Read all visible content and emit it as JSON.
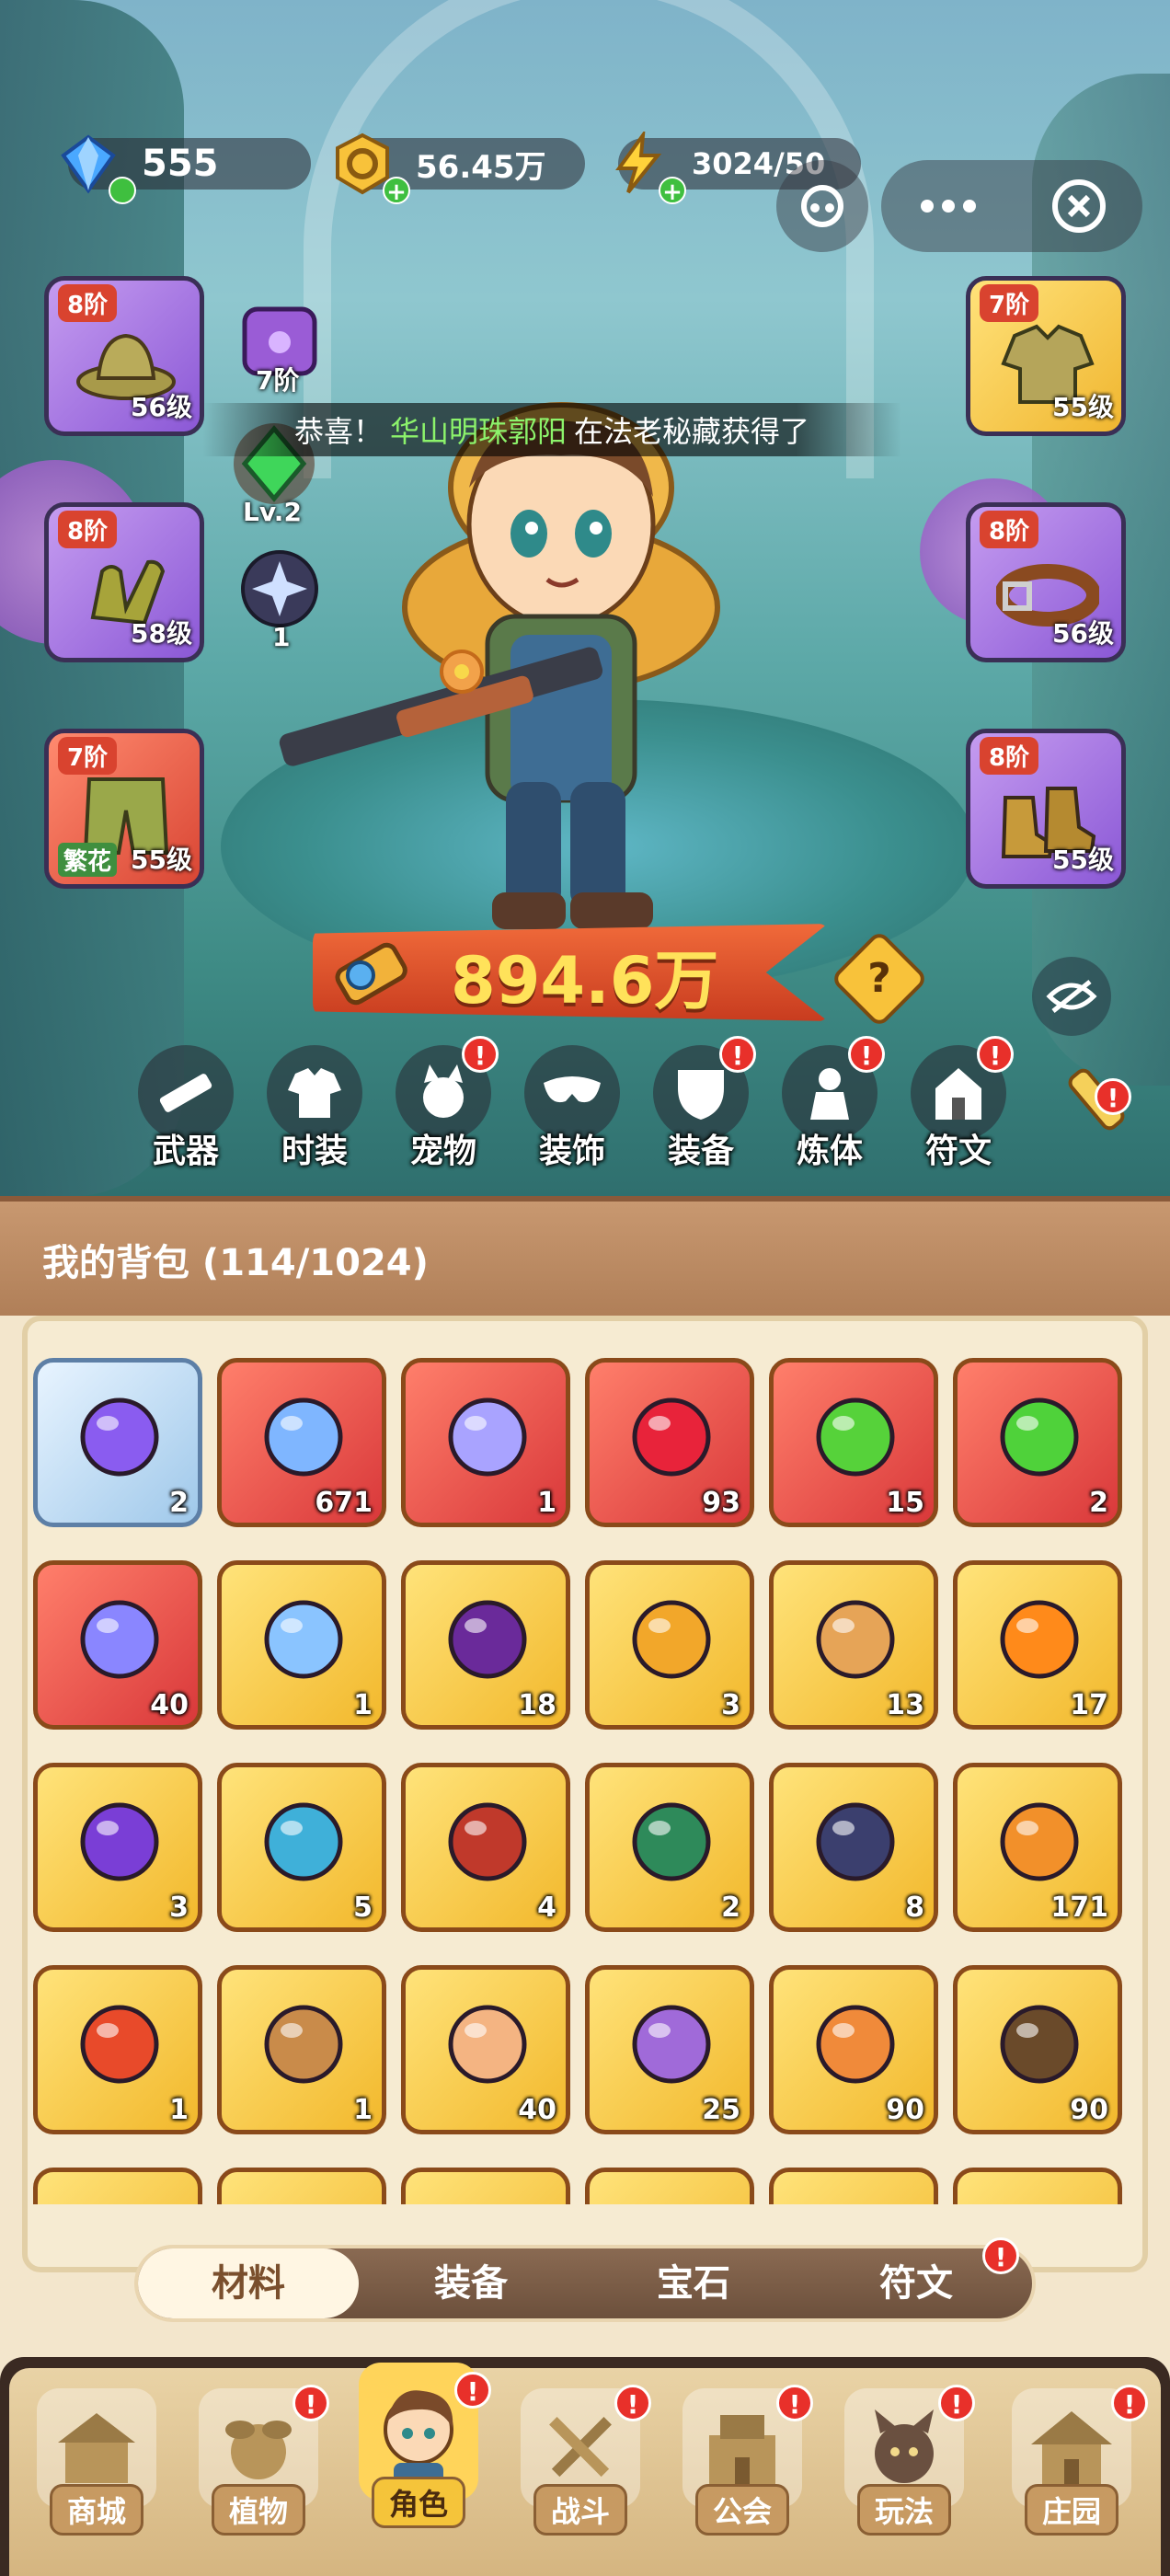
{
  "currencies": [
    {
      "name": "gem",
      "icon": "gem-icon",
      "value": "555"
    },
    {
      "name": "gold",
      "icon": "gold-coin-icon",
      "value": "56.45万"
    },
    {
      "name": "energy",
      "icon": "lightning-icon",
      "value": "3024/50"
    }
  ],
  "equipment_left": [
    {
      "tier": "8阶",
      "level": "56级",
      "icon": "hat-icon",
      "tag": ""
    },
    {
      "tier": "8阶",
      "level": "58级",
      "icon": "gloves-icon",
      "tag": ""
    },
    {
      "tier": "7阶",
      "level": "55级",
      "icon": "pants-icon",
      "tag": "繁花"
    }
  ],
  "equipment_right": [
    {
      "tier": "7阶",
      "level": "55级",
      "icon": "shirt-icon"
    },
    {
      "tier": "8阶",
      "level": "56级",
      "icon": "belt-icon"
    },
    {
      "tier": "8阶",
      "level": "55级",
      "icon": "boots-icon"
    }
  ],
  "side_icons": [
    {
      "label": "7阶",
      "icon": "paw-bag-icon"
    },
    {
      "label": "Lv.2",
      "icon": "green-gem-icon"
    },
    {
      "label": "1",
      "icon": "star-orb-icon"
    }
  ],
  "notice": {
    "prefix": "恭喜！",
    "player": "华山明珠郭阳",
    "suffix": "在法老秘藏获得了"
  },
  "power": "894.6万",
  "help_symbol": "?",
  "functions": [
    {
      "label": "武器",
      "icon": "weapon-icon",
      "alert": false
    },
    {
      "label": "时装",
      "icon": "outfit-icon",
      "alert": false
    },
    {
      "label": "宠物",
      "icon": "pet-icon",
      "alert": true
    },
    {
      "label": "装饰",
      "icon": "mask-icon",
      "alert": false
    },
    {
      "label": "装备",
      "icon": "equipment-icon",
      "alert": true
    },
    {
      "label": "炼体",
      "icon": "body-refine-icon",
      "alert": true
    },
    {
      "label": "符文",
      "icon": "rune-icon",
      "alert": true
    }
  ],
  "alert_symbol": "!",
  "bag": {
    "title": "我的背包 (114/1024)",
    "items": [
      {
        "icon": "golden-ring-icon",
        "count": "2",
        "rarity": "blue",
        "color": "#8a5cf0"
      },
      {
        "icon": "star-crystal-icon",
        "count": "671",
        "rarity": "red",
        "color": "#7fb6ff"
      },
      {
        "icon": "moon-star-icon",
        "count": "1",
        "rarity": "red",
        "color": "#a9a3ff"
      },
      {
        "icon": "red-potion-icon",
        "count": "93",
        "rarity": "red",
        "color": "#e8233a"
      },
      {
        "icon": "green-tube-icon",
        "count": "15",
        "rarity": "red",
        "color": "#56d23a"
      },
      {
        "icon": "green-capsule-icon",
        "count": "2",
        "rarity": "red",
        "color": "#4fd23a"
      },
      {
        "icon": "purple-cubes-icon",
        "count": "40",
        "rarity": "red",
        "color": "#8a86ff"
      },
      {
        "icon": "water-drop-icon",
        "count": "1",
        "rarity": "gold",
        "color": "#8ac4ff"
      },
      {
        "icon": "skull-scroll-icon",
        "count": "18",
        "rarity": "gold",
        "color": "#6a2a9a"
      },
      {
        "icon": "ruby-key-icon",
        "count": "3",
        "rarity": "gold",
        "color": "#f2a72a"
      },
      {
        "icon": "bronze-key-icon",
        "count": "13",
        "rarity": "gold",
        "color": "#e6a457"
      },
      {
        "icon": "fire-pyramid-icon",
        "count": "17",
        "rarity": "gold",
        "color": "#ff8a1a"
      },
      {
        "icon": "purple-orb-icon",
        "count": "3",
        "rarity": "gold",
        "color": "#7a3ed6"
      },
      {
        "icon": "blue-mushroom-icon",
        "count": "5",
        "rarity": "gold",
        "color": "#3fb0d9"
      },
      {
        "icon": "red-book-icon",
        "count": "4",
        "rarity": "gold",
        "color": "#c0392b"
      },
      {
        "icon": "green-cube-icon",
        "count": "2",
        "rarity": "gold",
        "color": "#2e8a5a"
      },
      {
        "icon": "dark-rune-stone-icon",
        "count": "8",
        "rarity": "gold",
        "color": "#3b3f6e"
      },
      {
        "icon": "orange-potion-icon",
        "count": "171",
        "rarity": "gold",
        "color": "#f2902a"
      },
      {
        "icon": "red-flower-icon",
        "count": "1",
        "rarity": "gold",
        "color": "#e84a2a"
      },
      {
        "icon": "flower-pot-icon",
        "count": "1",
        "rarity": "gold",
        "color": "#c98b4a"
      },
      {
        "icon": "cake-icon",
        "count": "40",
        "rarity": "gold",
        "color": "#f4b482"
      },
      {
        "icon": "purple-book-icon",
        "count": "25",
        "rarity": "gold",
        "color": "#a06ad9"
      },
      {
        "icon": "jar-icon",
        "count": "90",
        "rarity": "gold",
        "color": "#f08a3a"
      },
      {
        "icon": "refresh-card-icon",
        "count": "90",
        "rarity": "gold",
        "color": "#6a4a2a"
      }
    ]
  },
  "tabs": [
    {
      "label": "材料",
      "active": true,
      "alert": false
    },
    {
      "label": "装备",
      "active": false,
      "alert": false
    },
    {
      "label": "宝石",
      "active": false,
      "alert": false
    },
    {
      "label": "符文",
      "active": false,
      "alert": true
    }
  ],
  "bottom_nav": [
    {
      "label": "商城",
      "icon": "shop-icon",
      "active": false,
      "alert": false
    },
    {
      "label": "植物",
      "icon": "plant-icon",
      "active": false,
      "alert": true
    },
    {
      "label": "角色",
      "icon": "character-icon",
      "active": true,
      "alert": true
    },
    {
      "label": "战斗",
      "icon": "battle-icon",
      "active": false,
      "alert": true
    },
    {
      "label": "公会",
      "icon": "guild-icon",
      "active": false,
      "alert": true
    },
    {
      "label": "玩法",
      "icon": "gameplay-icon",
      "active": false,
      "alert": true
    },
    {
      "label": "庄园",
      "icon": "manor-icon",
      "active": false,
      "alert": true
    }
  ]
}
